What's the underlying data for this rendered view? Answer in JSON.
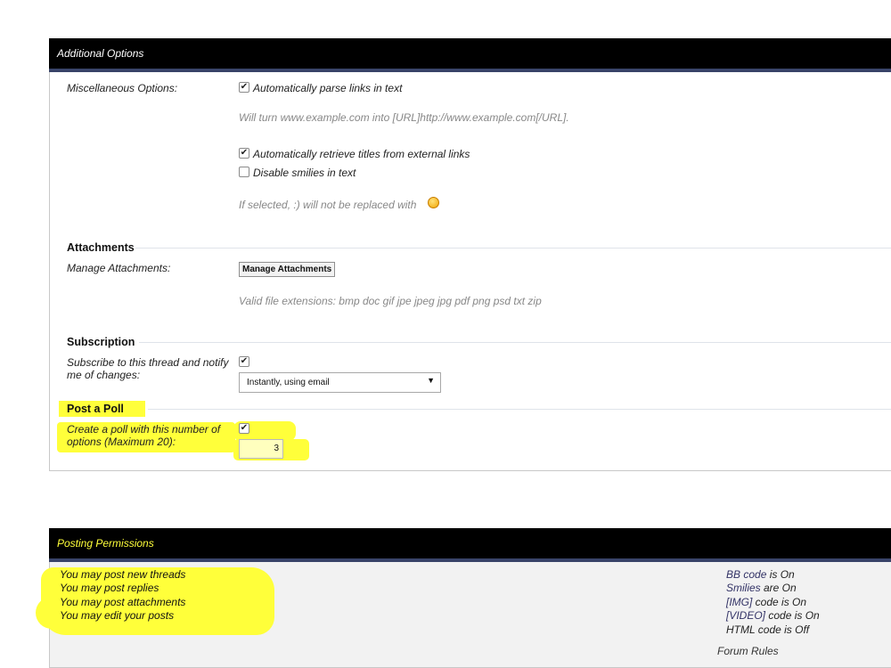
{
  "additional_options": {
    "title": "Additional Options",
    "misc_label": "Miscellaneous Options:",
    "parse_links_label": "Automatically parse links in text",
    "parse_links_checked": true,
    "parse_links_hint": "Will turn www.example.com into [URL]http://www.example.com[/URL].",
    "retrieve_titles_label": "Automatically retrieve titles from external links",
    "retrieve_titles_checked": true,
    "disable_smilies_label": "Disable smilies in text",
    "disable_smilies_checked": false,
    "smilies_hint": "If selected, :) will not be replaced with"
  },
  "attachments": {
    "heading": "Attachments",
    "manage_label": "Manage Attachments:",
    "manage_button": "Manage Attachments",
    "valid_ext_hint": "Valid file extensions: bmp doc gif jpe jpeg jpg pdf png psd txt zip"
  },
  "subscription": {
    "heading": "Subscription",
    "subscribe_label": "Subscribe to this thread and notify me of changes:",
    "subscribe_checked": true,
    "mode_value": "Instantly, using email"
  },
  "poll": {
    "heading": "Post a Poll",
    "create_label": "Create a poll with this number of options (Maximum 20):",
    "create_checked": true,
    "options_count": "3"
  },
  "posting_permissions": {
    "title": "Posting Permissions",
    "left": [
      "You may post new threads",
      "You may post replies",
      "You may post attachments",
      "You may edit your posts"
    ],
    "bb_code_link": "BB code",
    "bb_code_rest": " is On",
    "smilies_link": "Smilies",
    "smilies_rest": " are On",
    "img_link": "[IMG]",
    "img_rest": " code is On",
    "video_link": "[VIDEO]",
    "video_rest": " code is On",
    "html_line": "HTML code is Off",
    "forum_rules": "Forum Rules"
  },
  "colors": {
    "header_bg": "#000000",
    "header_underline": "#394469",
    "highlight": "#ffff3a",
    "link": "#333366"
  }
}
